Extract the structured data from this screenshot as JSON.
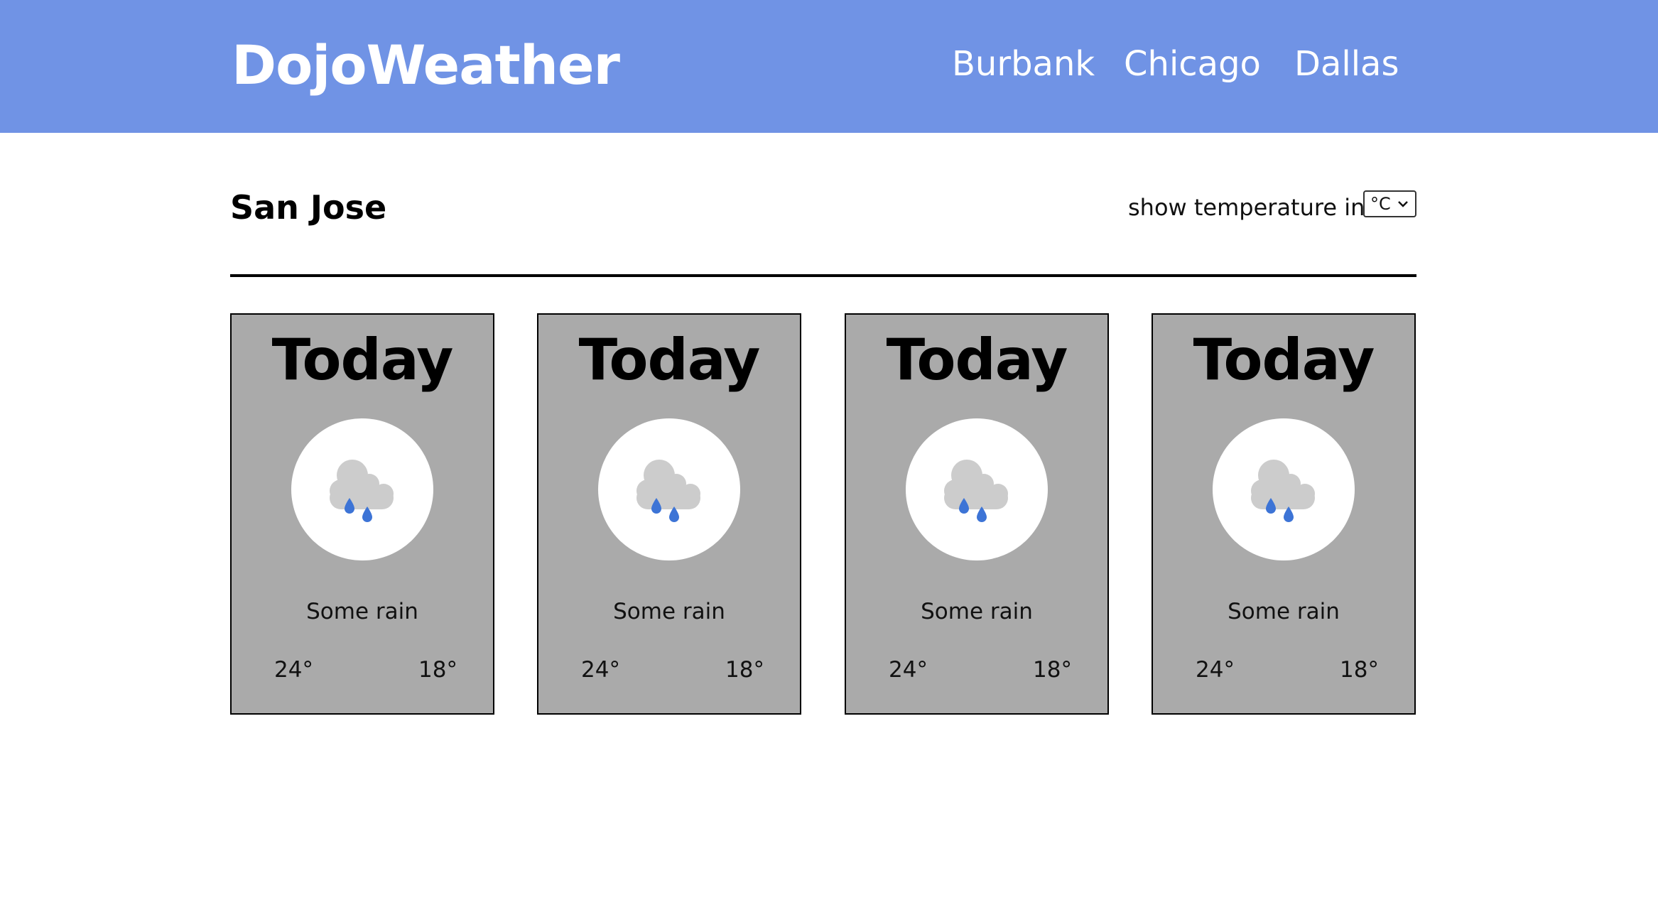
{
  "header": {
    "brand": "DojoWeather",
    "nav": [
      "Burbank",
      "Chicago",
      "Dallas"
    ]
  },
  "main": {
    "city": "San Jose",
    "unit_label": "show temperature in",
    "unit_selected": "°C"
  },
  "forecast": [
    {
      "day": "Today",
      "icon": "rain-cloud-icon",
      "description": "Some rain",
      "high": "24°",
      "low": "18°"
    },
    {
      "day": "Today",
      "icon": "rain-cloud-icon",
      "description": "Some rain",
      "high": "24°",
      "low": "18°"
    },
    {
      "day": "Today",
      "icon": "rain-cloud-icon",
      "description": "Some rain",
      "high": "24°",
      "low": "18°"
    },
    {
      "day": "Today",
      "icon": "rain-cloud-icon",
      "description": "Some rain",
      "high": "24°",
      "low": "18°"
    }
  ],
  "colors": {
    "header_bg": "#7093e5",
    "card_bg": "#aaaaaa",
    "cloud": "#cccccc",
    "raindrop": "#3d74d6"
  }
}
